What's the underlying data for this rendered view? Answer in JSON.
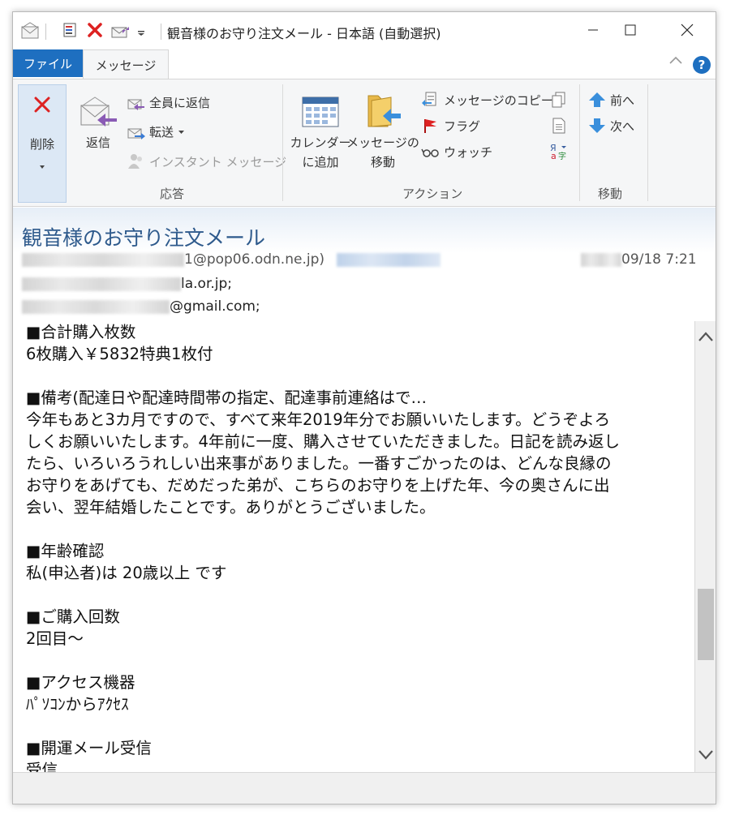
{
  "window": {
    "title": "観音様のお守り注文メール - 日本語 (自動選択)"
  },
  "tabs": {
    "file": "ファイル",
    "message": "メッセージ"
  },
  "ribbon": {
    "delete": "削除",
    "reply": "返信",
    "reply_all": "全員に返信",
    "forward": "転送",
    "instant_message": "インスタント メッセージ",
    "group_respond": "応答",
    "calendar_line1": "カレンダー",
    "calendar_line2": "に追加",
    "move_line1": "メッセージの",
    "move_line2": "移動",
    "copy_message": "メッセージのコピー",
    "flag": "フラグ",
    "watch": "ウォッチ",
    "group_actions": "アクション",
    "prev": "前へ",
    "next": "次へ",
    "group_move": "移動"
  },
  "header": {
    "subject": "観音様のお守り注文メール",
    "from_suffix": "1@pop06.odn.ne.jp)",
    "date": "09/18 7:21",
    "to_suffix": "la.or.jp;",
    "cc_suffix": "@gmail.com;"
  },
  "body": {
    "lines": [
      "■合計購入枚数",
      "6枚購入￥5832特典1枚付",
      "",
      "■備考(配達日や配達時間帯の指定、配達事前連絡はで…",
      "今年もあと3カ月ですので、すべて来年2019年分でお願いいたします。どうぞよろ",
      "しくお願いいたします。4年前に一度、購入させていただきました。日記を読み返し",
      "たら、いろいろうれしい出来事がありました。一番すごかったのは、どんな良縁の",
      "お守りをあげても、だめだった弟が、こちらのお守りを上げた年、今の奥さんに出",
      "会い、翌年結婚したことです。ありがとうございました。",
      "",
      "■年齢確認",
      "私(申込者)は 20歳以上 です",
      "",
      "■ご購入回数",
      "2回目～",
      "",
      "■アクセス機器",
      "ﾊﾟｿｺﾝからｱｸｾｽ",
      "",
      "■開運メール受信",
      "受信"
    ]
  },
  "colors": {
    "accent": "#1e6fc0",
    "subject": "#2e5a8c"
  }
}
